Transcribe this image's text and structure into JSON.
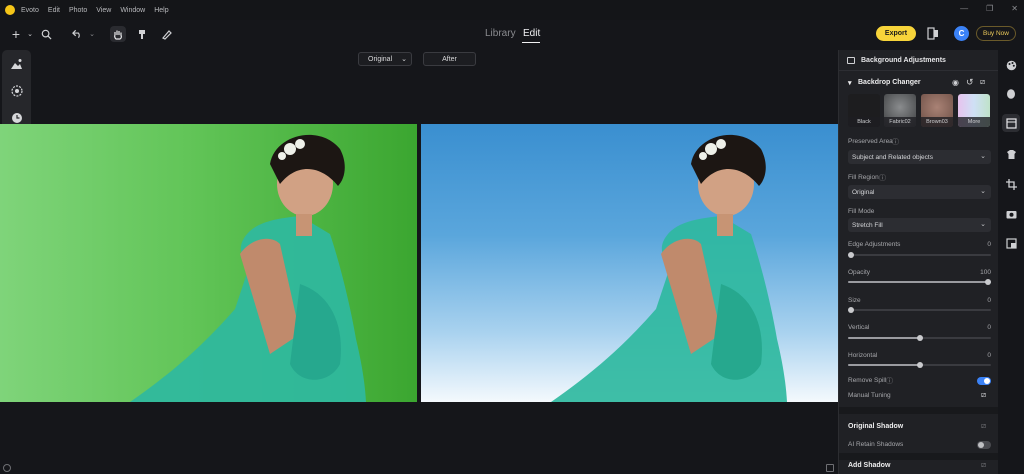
{
  "titlebar": {
    "app_name": "Evoto",
    "menu": [
      "Edit",
      "Photo",
      "View",
      "Window",
      "Help"
    ],
    "window_controls": [
      "minimize-icon",
      "maximize-icon",
      "close-icon"
    ]
  },
  "toolbar": {
    "tabs": [
      "Library",
      "Edit"
    ],
    "active_tab": "Edit",
    "export_label": "Export",
    "buy_label": "Buy Now",
    "avatar_initial": "C",
    "icons": [
      "plus-icon",
      "search-icon",
      "undo-icon",
      "hand-icon",
      "brush-icon",
      "eraser-icon"
    ]
  },
  "compare": {
    "original_label": "Original",
    "after_label": "After"
  },
  "left_tools": [
    "portrait-icon",
    "aperture-icon",
    "clock-icon"
  ],
  "panel": {
    "header": "Background Adjustments",
    "section": "Backdrop Changer",
    "thumbnails": [
      {
        "label": "Black",
        "color": "#1d1d1f"
      },
      {
        "label": "Fabric02",
        "color": "#5a5c5e"
      },
      {
        "label": "Brown03",
        "color": "#8f6b60"
      },
      {
        "label": "More",
        "color": "#c9a9d8"
      }
    ],
    "preserved_area": {
      "label": "Preserved Area",
      "value": "Subject and Related objects"
    },
    "fill_region": {
      "label": "Fill Region",
      "value": "Original"
    },
    "fill_mode": {
      "label": "Fill Mode",
      "value": "Stretch Fill"
    },
    "sliders": [
      {
        "label": "Edge Adjustments",
        "value": "0",
        "fraction": 0.0
      },
      {
        "label": "Opacity",
        "value": "100",
        "fraction": 1.0
      },
      {
        "label": "Size",
        "value": "0",
        "fraction": 0.0
      },
      {
        "label": "Vertical",
        "value": "0",
        "fraction": 0.5
      },
      {
        "label": "Horizontal",
        "value": "0",
        "fraction": 0.5
      }
    ],
    "remove_spill": {
      "label": "Remove Spill",
      "on": true
    },
    "manual_tuning": "Manual Tuning",
    "original_shadow": {
      "title": "Original Shadow",
      "ai_retain_label": "AI Retain Shadows",
      "on": false
    },
    "add_shadow": "Add Shadow"
  },
  "rail": [
    "palette-icon",
    "face-icon",
    "background-icon",
    "shirt-icon",
    "crop-icon",
    "camera-icon",
    "gallery-icon"
  ],
  "colors": {
    "accent_yellow": "#f7d43a",
    "toggle_blue": "#3b82f6",
    "green_screen": "#62c558",
    "sky_blue": "#3a8fd0"
  }
}
